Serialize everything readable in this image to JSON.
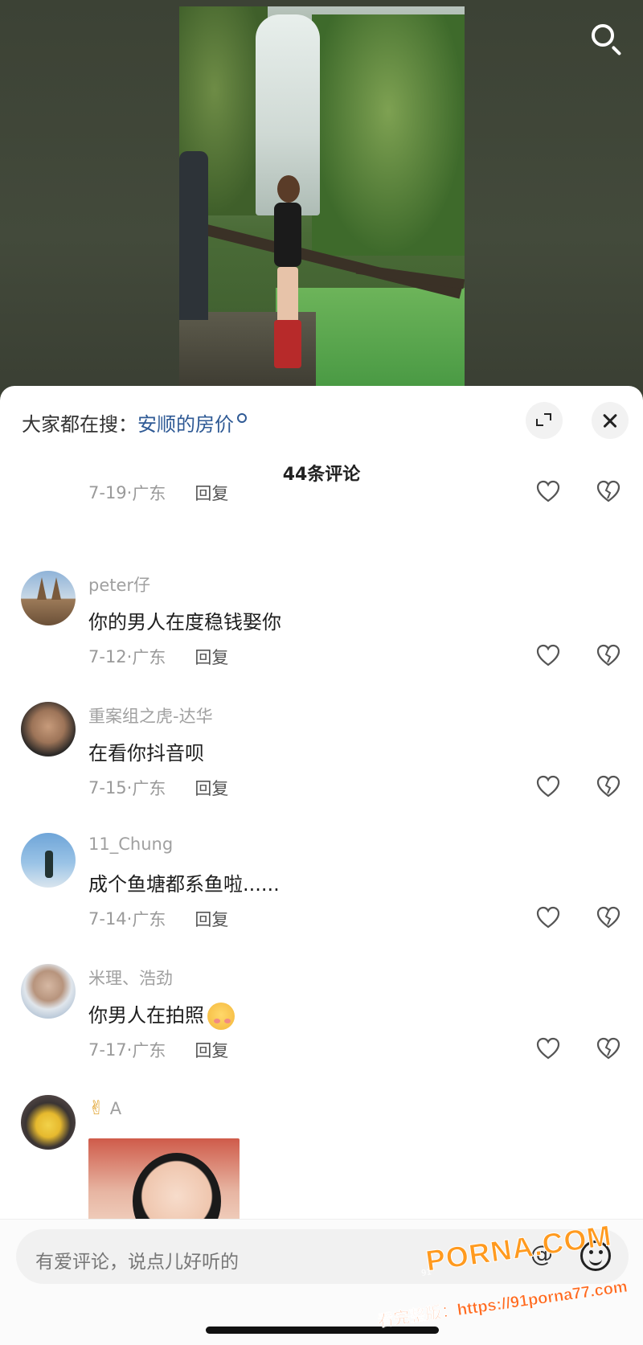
{
  "video": {},
  "sheet": {
    "search_prefix": "大家都在搜：",
    "search_term": "安顺的房价",
    "comment_count": "44条评论"
  },
  "first_meta": {
    "date": "7-19",
    "sep": "·",
    "location": "广东",
    "reply": "回复"
  },
  "comments": [
    {
      "user": "peter仔",
      "text": "你的男人在度稳钱娶你",
      "date": "7-12",
      "sep": "·",
      "location": "广东",
      "reply": "回复"
    },
    {
      "user": "重案组之虎-达华",
      "text": "在看你抖音呗",
      "date": "7-15",
      "sep": "·",
      "location": "广东",
      "reply": "回复"
    },
    {
      "user": "11_Chung",
      "text": "成个鱼塘都系鱼啦......",
      "date": "7-14",
      "sep": "·",
      "location": "广东",
      "reply": "回复"
    },
    {
      "user": "米理、浩劲",
      "text": "你男人在拍照",
      "date": "7-17",
      "sep": "·",
      "location": "广东",
      "reply": "回复"
    },
    {
      "user": "A",
      "user_prefix": "✌"
    }
  ],
  "input": {
    "placeholder": "有爱评论，说点儿好听的",
    "at_symbol": "@"
  },
  "watermark": {
    "brand": "PORNA.COM",
    "url": "看完整版：https://91porna77.com",
    "small": "91"
  },
  "icons": [
    "search-icon",
    "expand-icon",
    "close-icon",
    "heart-icon",
    "broken-heart-icon",
    "at-icon",
    "emoji-icon"
  ]
}
